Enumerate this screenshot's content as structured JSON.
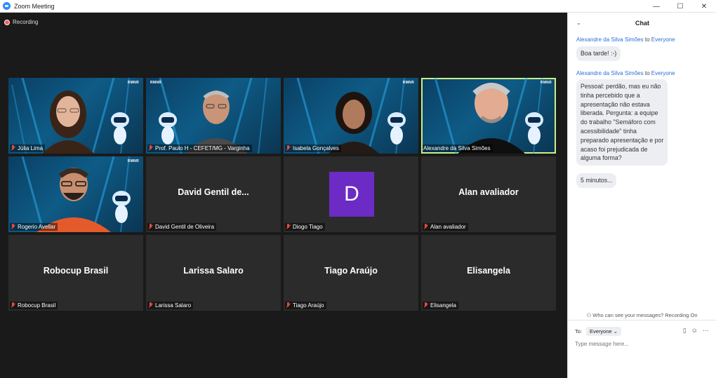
{
  "window": {
    "title": "Zoom Meeting",
    "controls": [
      "—",
      "☐",
      "✕"
    ]
  },
  "meeting": {
    "recording_label": "Recording",
    "tiles": [
      {
        "name": "Júlia Lima",
        "type": "video"
      },
      {
        "name": "Prof. Paulo H - CEFET/MG - Varginha",
        "type": "video"
      },
      {
        "name": "Isabela Gonçalves",
        "type": "video"
      },
      {
        "name": "Alexandre da Silva Simões",
        "type": "video",
        "active": true
      },
      {
        "name": "Rogerio Avellar",
        "type": "video"
      },
      {
        "name": "David Gentil de Oliveira",
        "display_name": "David Gentil de...",
        "type": "name"
      },
      {
        "name": "Diogo Tiago",
        "type": "avatar",
        "initial": "D"
      },
      {
        "name": "Alan avaliador",
        "display_name": "Alan avaliador",
        "type": "name"
      },
      {
        "name": "Robocup Brasil",
        "display_name": "Robocup Brasil",
        "type": "name"
      },
      {
        "name": "Larissa Salaro",
        "display_name": "Larissa Salaro",
        "type": "name"
      },
      {
        "name": "Tiago Araújo",
        "display_name": "Tiago Araújo",
        "type": "name"
      },
      {
        "name": "Elisangela",
        "display_name": "Elisangela",
        "type": "name"
      }
    ],
    "logo_badge": "RMNR"
  },
  "chat": {
    "title": "Chat",
    "messages": [
      {
        "from": "Alexandre da Silva Simões",
        "to_word": "to",
        "target": "Everyone",
        "lines": [
          "Boa tarde! :-)"
        ]
      },
      {
        "from": "Alexandre da Silva Simões",
        "to_word": "to",
        "target": "Everyone",
        "lines": [
          "Pessoal: perdão, mas eu não",
          "tinha percebido que a",
          "apresentação não estava",
          "liberada. Pergunta: a equipe",
          "do trabalho \"Semáforo com",
          "acessibilidade\" tinha",
          "preparado apresentação e por",
          "acaso foi prejudicada de",
          "alguma forma?"
        ]
      },
      {
        "lines": [
          "5 minutos..."
        ]
      }
    ],
    "who_can_see": "Who can see your messages? Recording On",
    "to_label": "To:",
    "to_value": "Everyone",
    "input_placeholder": "Type message here..."
  },
  "colors": {
    "accent": "#2d8cff",
    "active_border": "#c9f08a",
    "avatar": "#6c2bc4",
    "mic_muted": "#e74c3c"
  }
}
